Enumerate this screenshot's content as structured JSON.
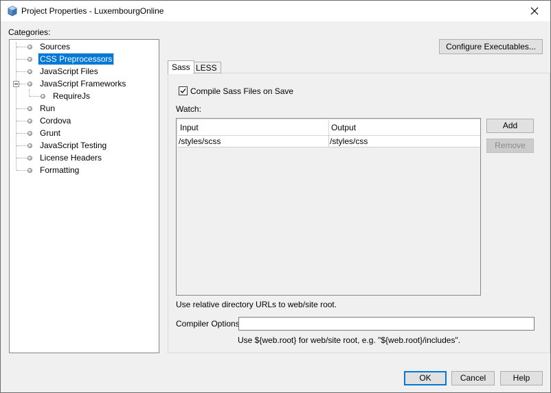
{
  "window": {
    "title": "Project Properties - LuxembourgOnline",
    "close_icon": "close-icon",
    "app_icon": "netbeans-cube-icon"
  },
  "categories": {
    "label": "Categories:",
    "items": [
      {
        "label": "Sources",
        "level": 0,
        "selected": false
      },
      {
        "label": "CSS Preprocessors",
        "level": 0,
        "selected": true
      },
      {
        "label": "JavaScript Files",
        "level": 0,
        "selected": false
      },
      {
        "label": "JavaScript Frameworks",
        "level": 0,
        "selected": false,
        "expanded": true
      },
      {
        "label": "RequireJs",
        "level": 1,
        "selected": false
      },
      {
        "label": "Run",
        "level": 0,
        "selected": false
      },
      {
        "label": "Cordova",
        "level": 0,
        "selected": false
      },
      {
        "label": "Grunt",
        "level": 0,
        "selected": false
      },
      {
        "label": "JavaScript Testing",
        "level": 0,
        "selected": false
      },
      {
        "label": "License Headers",
        "level": 0,
        "selected": false
      },
      {
        "label": "Formatting",
        "level": 0,
        "selected": false
      }
    ]
  },
  "configure_button": "Configure Executables...",
  "tabs": [
    {
      "label": "Sass",
      "active": true
    },
    {
      "label": "LESS",
      "active": false
    }
  ],
  "sass": {
    "compile_label": "Compile Sass Files on Save",
    "compile_checked": true,
    "watch_label": "Watch:",
    "columns": [
      "Input",
      "Output"
    ],
    "rows": [
      {
        "input": "/styles/scss",
        "output": "/styles/css"
      }
    ],
    "add_button": "Add",
    "remove_button": "Remove",
    "relative_hint": "Use relative directory URLs to web/site root.",
    "compiler_label": "Compiler Options:",
    "compiler_value": "",
    "webroot_hint": "Use ${web.root} for web/site root, e.g. \"${web.root}/includes\"."
  },
  "footer": {
    "ok": "OK",
    "cancel": "Cancel",
    "help": "Help"
  }
}
